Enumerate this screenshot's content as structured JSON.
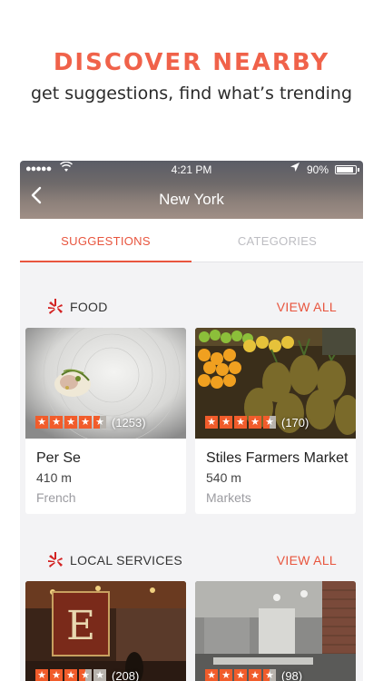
{
  "promo": {
    "title": "DISCOVER NEARBY",
    "subtitle": "get suggestions, find what’s trending"
  },
  "status_bar": {
    "signal": "●●●●●",
    "time": "4:21 PM",
    "battery": "90%"
  },
  "nav": {
    "title": "New York",
    "back_icon": "chevron-left-icon"
  },
  "tabs": [
    {
      "label": "SUGGESTIONS",
      "active": true
    },
    {
      "label": "CATEGORIES",
      "active": false
    }
  ],
  "sections": [
    {
      "title": "FOOD",
      "view_all": "VIEW ALL",
      "cards": [
        {
          "name": "Per Se",
          "distance": "410 m",
          "category": "French",
          "rating": 4.5,
          "review_count": "(1253)"
        },
        {
          "name": "Stiles Farmers Market",
          "distance": "540 m",
          "category": "Markets",
          "rating": 4.5,
          "review_count": "(170)"
        }
      ]
    },
    {
      "title": "LOCAL SERVICES",
      "view_all": "VIEW ALL",
      "cards": [
        {
          "rating": 3.5,
          "review_count": "(208)"
        },
        {
          "rating": 4.5,
          "review_count": "(98)"
        }
      ]
    }
  ],
  "colors": {
    "accent": "#e8553e",
    "star": "#f15c2b",
    "background": "#f3f3f5"
  }
}
